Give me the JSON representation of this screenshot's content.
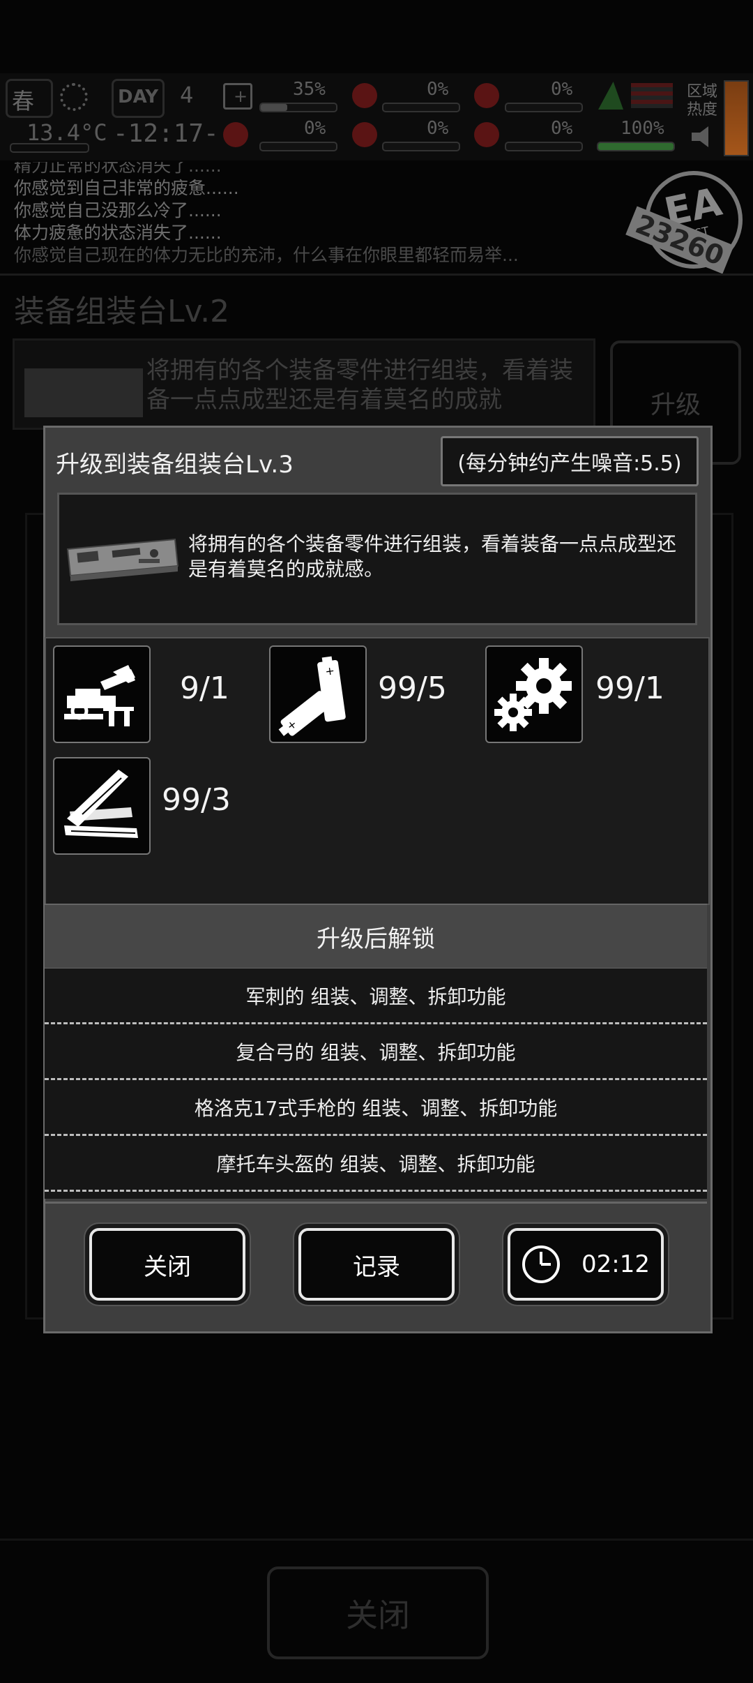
{
  "hud": {
    "season": "春",
    "day_label": "DAY",
    "day_number": "4",
    "temperature": "13.4°C",
    "time": "-12:17-",
    "stats_row1": [
      "35%",
      "0%",
      "0%"
    ],
    "stats_row2": [
      "0%",
      "0%",
      "0%",
      "100%"
    ],
    "stat_levels_row1": [
      0.35,
      0,
      0
    ],
    "stat_levels_row2": [
      0,
      0,
      0,
      1.0
    ],
    "zone_heat_label": "区域\n热度",
    "accent_red": "#5a1414"
  },
  "log": {
    "lines": [
      "精力正常的状态消失了......",
      "你感觉到自己非常的疲惫......",
      "你感觉自己没那么冷了......",
      "体力疲惫的状态消失了......",
      "你感觉自己现在的体力无比的充沛，什么事在你眼里都轻而易举..."
    ]
  },
  "badge": {
    "text": "EA",
    "sub": "TEST",
    "number": "23260"
  },
  "background": {
    "title": "装备组装台Lv.2",
    "description": "将拥有的各个装备零件进行组装，看着装备一点点成型还是有着莫名的成就",
    "upgrade_label": "升级",
    "close_label": "关闭"
  },
  "dialog": {
    "title": "升级到装备组装台Lv.3",
    "noise": "(每分钟约产生噪音:5.5)",
    "description": "将拥有的各个装备零件进行组装，看着装备一点点成型还是有着莫名的成就感。",
    "materials": [
      {
        "icon": "vise-icon",
        "count": "9/1"
      },
      {
        "icon": "battery-icon",
        "count": "99/5"
      },
      {
        "icon": "gears-icon",
        "count": "99/1"
      },
      {
        "icon": "wood-planks-icon",
        "count": "99/3"
      }
    ],
    "unlock_heading": "升级后解锁",
    "unlocks": [
      "军刺的 组装、调整、拆卸功能",
      "复合弓的 组装、调整、拆卸功能",
      "格洛克17式手枪的 组装、调整、拆卸功能",
      "摩托车头盔的 组装、调整、拆卸功能"
    ],
    "buttons": {
      "close": "关闭",
      "record": "记录",
      "timer": "02:12"
    }
  }
}
